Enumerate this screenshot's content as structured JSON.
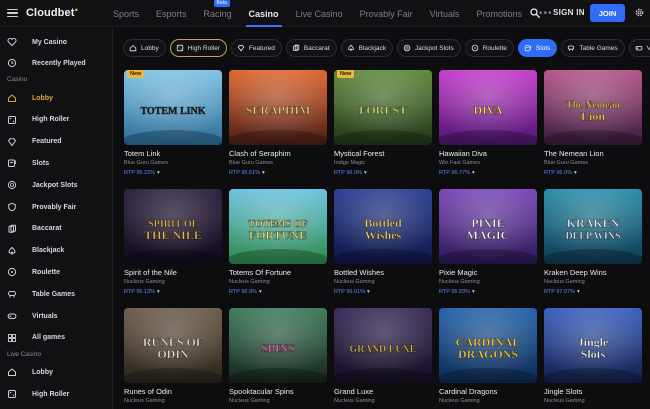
{
  "header": {
    "logo": "Cloudbet",
    "nav": [
      {
        "label": "Sports",
        "active": false
      },
      {
        "label": "Esports",
        "active": false
      },
      {
        "label": "Racing",
        "active": false,
        "badge": "Beta"
      },
      {
        "label": "Casino",
        "active": true
      },
      {
        "label": "Live Casino",
        "active": false
      },
      {
        "label": "Provably Fair",
        "active": false
      },
      {
        "label": "Virtuals",
        "active": false
      },
      {
        "label": "Promotions",
        "active": false
      }
    ],
    "more": "•••",
    "signin": "SIGN IN",
    "join": "JOIN"
  },
  "sidebar": {
    "items": [
      {
        "label": "My Casino",
        "icon": "heart-icon"
      },
      {
        "label": "Recently Played",
        "icon": "clock-icon"
      }
    ],
    "casino_section": "Casino",
    "casino_items": [
      {
        "label": "Lobby",
        "icon": "home-icon",
        "active": true
      },
      {
        "label": "High Roller",
        "icon": "dice-icon"
      },
      {
        "label": "Featured",
        "icon": "diamond-icon"
      },
      {
        "label": "Slots",
        "icon": "slot-icon"
      },
      {
        "label": "Jackpot Slots",
        "icon": "chip-icon"
      },
      {
        "label": "Provably Fair",
        "icon": "shield-icon"
      },
      {
        "label": "Baccarat",
        "icon": "cards-icon"
      },
      {
        "label": "Blackjack",
        "icon": "spade-icon"
      },
      {
        "label": "Roulette",
        "icon": "roulette-icon"
      },
      {
        "label": "Table Games",
        "icon": "table-icon"
      },
      {
        "label": "Virtuals",
        "icon": "gamepad-icon"
      },
      {
        "label": "All games",
        "icon": "grid-icon"
      }
    ],
    "live_section": "Live Casino",
    "live_items": [
      {
        "label": "Lobby",
        "icon": "home-icon"
      },
      {
        "label": "High Roller",
        "icon": "dice-icon"
      }
    ]
  },
  "filters": [
    {
      "label": "Lobby",
      "icon": "home-icon",
      "state": "normal"
    },
    {
      "label": "High Roller",
      "icon": "dice-icon",
      "state": "active"
    },
    {
      "label": "Featured",
      "icon": "diamond-icon",
      "state": "normal"
    },
    {
      "label": "Baccarat",
      "icon": "cards-icon",
      "state": "normal"
    },
    {
      "label": "Blackjack",
      "icon": "spade-icon",
      "state": "normal"
    },
    {
      "label": "Jackpot Slots",
      "icon": "chip-icon",
      "state": "normal"
    },
    {
      "label": "Roulette",
      "icon": "roulette-icon",
      "state": "normal"
    },
    {
      "label": "Slots",
      "icon": "slot-icon",
      "state": "selected"
    },
    {
      "label": "Table Games",
      "icon": "table-icon",
      "state": "normal"
    },
    {
      "label": "Virtuals",
      "icon": "gamepad-icon",
      "state": "normal"
    }
  ],
  "games": [
    {
      "title": "Totem Link",
      "provider": "Blue Guru Games",
      "rtp": "RTP 95.23%",
      "new": true,
      "art_text": "TOTEM LINK",
      "bg1": "#7ec3e6",
      "bg2": "#2d6d98",
      "fg": "#1f1f1f"
    },
    {
      "title": "Clash of Seraphim",
      "provider": "Blue Guru Games",
      "rtp": "RTP 95.51%",
      "new": false,
      "art_text": "SERAPHIM",
      "bg1": "#e0662c",
      "bg2": "#4a1e19",
      "fg": "#f5d27a"
    },
    {
      "title": "Mystical Forest",
      "provider": "Indigo Magic",
      "rtp": "RTP 96.0%",
      "new": true,
      "art_text": "FOREST",
      "bg1": "#5f8a3c",
      "bg2": "#233619",
      "fg": "#cfe67a"
    },
    {
      "title": "Hawaiian Diva",
      "provider": "Win Fast Games",
      "rtp": "RTP 96.77%",
      "new": false,
      "art_text": "DIVA",
      "bg1": "#c53ccd",
      "bg2": "#4d1670",
      "fg": "#ffe04d"
    },
    {
      "title": "The Nemean Lion",
      "provider": "Blue Guru Games",
      "rtp": "RTP 96.0%",
      "new": false,
      "art_text": "The Nemean Lion",
      "bg1": "#b5558a",
      "bg2": "#3b1d3e",
      "fg": "#ffd24d"
    },
    {
      "title": "Spirit of the Nile",
      "provider": "Nucleus Gaming",
      "rtp": "RTP 96.13%",
      "new": false,
      "art_text": "SPIRIT OF THE NILE",
      "bg1": "#2d2040",
      "bg2": "#120c1e",
      "fg": "#e8b94c"
    },
    {
      "title": "Totems Of Fortune",
      "provider": "Nucleus Gaming",
      "rtp": "RTP 96.9%",
      "new": false,
      "art_text": "TOTEMS OF FORTUNE",
      "bg1": "#6ac2e0",
      "bg2": "#2f8a4a",
      "fg": "#f6e07a"
    },
    {
      "title": "Bottled Wishes",
      "provider": "Nucleus Gaming",
      "rtp": "RTP 96.01%",
      "new": false,
      "art_text": "Bottled Wishes",
      "bg1": "#2a3e92",
      "bg2": "#0f1848",
      "fg": "#f2d36a"
    },
    {
      "title": "Pixie Magic",
      "provider": "Nucleus Gaming",
      "rtp": "RTP 95.83%",
      "new": false,
      "art_text": "PIXIE MAGIC",
      "bg1": "#7a47b8",
      "bg2": "#2b1a58",
      "fg": "#ffffff"
    },
    {
      "title": "Kraken Deep Wins",
      "provider": "Nucleus Gaming",
      "rtp": "RTP 97.07%",
      "new": false,
      "art_text": "KRAKEN DEEP WINS",
      "bg1": "#2a8ea8",
      "bg2": "#0d3a52",
      "fg": "#e8f6ff"
    },
    {
      "title": "Runes of Odin",
      "provider": "Nucleus Gaming",
      "rtp": "",
      "new": false,
      "art_text": "RUNES OF ODIN",
      "bg1": "#6b5c4a",
      "bg2": "#2a241d",
      "fg": "#efe8da"
    },
    {
      "title": "Spooktacular Spins",
      "provider": "Nucleus Gaming",
      "rtp": "",
      "new": false,
      "art_text": "SPINS",
      "bg1": "#3c7a5a",
      "bg2": "#17261d",
      "fg": "#e86bb0"
    },
    {
      "title": "Grand Luxe",
      "provider": "Nucleus Gaming",
      "rtp": "",
      "new": false,
      "art_text": "GRAND LUXE",
      "bg1": "#3a2a5a",
      "bg2": "#150f24",
      "fg": "#e8b94c"
    },
    {
      "title": "Cardinal Dragons",
      "provider": "Nucleus Gaming",
      "rtp": "",
      "new": false,
      "art_text": "CARDINAL DRAGONS",
      "bg1": "#2563a8",
      "bg2": "#0f2c55",
      "fg": "#ffcf3a"
    },
    {
      "title": "Jingle Slots",
      "provider": "Nucleus Gaming",
      "rtp": "",
      "new": false,
      "art_text": "Jingle Slots",
      "bg1": "#3b5fbf",
      "bg2": "#14204d",
      "fg": "#ffffff"
    }
  ],
  "colors": {
    "accent": "#2f6df6",
    "active_gold": "#e2a43a",
    "rtp_blue": "#5b8cf7"
  }
}
